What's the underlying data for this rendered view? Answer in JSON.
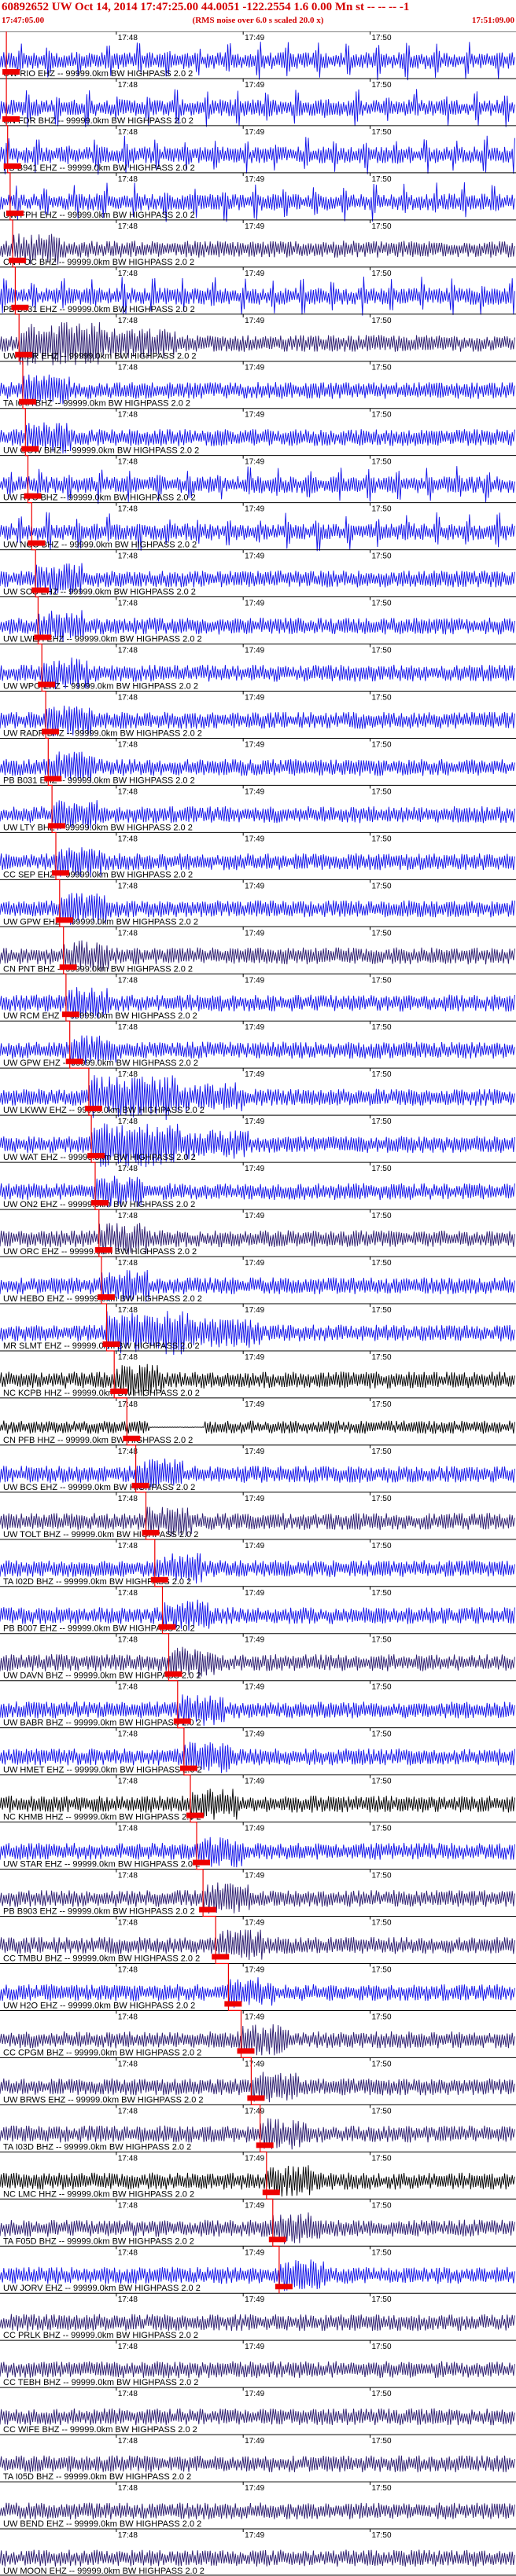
{
  "header": {
    "title": "60892652 UW Oct 14, 2014 17:47:25.00   44.0051 -122.2554  1.6 0.00 Mn st -- -- -- -1",
    "start_time": "17:47:05.00",
    "note": "(RMS noise over 6.0 s scaled 20.0 x)",
    "end_time": "17:51:09.00"
  },
  "time_axis": {
    "tick_labels": [
      "17:48",
      "17:49",
      "17:50"
    ],
    "start_minutes": 0.0,
    "end_minutes": 4.0667,
    "tick_minutes": [
      0.9167,
      1.9167,
      2.9167
    ]
  },
  "colors": {
    "trace_blue": "#1010e8",
    "trace_indigo": "#2a1a6e",
    "trace_black": "#000000",
    "pick": "#ee0000",
    "header_text": "#d40000"
  },
  "traces": [
    {
      "label": "UW RIO EHZ -- 99999.0km BW  HIGHPASS  2.0  2",
      "color": "blue",
      "style": "bursty",
      "pick_min": 0.05
    },
    {
      "label": "CN FDR BHZ -- 99999.0km BW  HIGHPASS  2.0  2",
      "color": "blue",
      "style": "bursty",
      "pick_min": 0.05
    },
    {
      "label": "PB B941 EHZ -- 99999.0km BW  HIGHPASS  2.0  2",
      "color": "blue",
      "style": "bursty",
      "pick_min": 0.06
    },
    {
      "label": "UW FPH EHZ -- 99999.0km BW  HIGHPASS  2.0  2",
      "color": "blue",
      "style": "bursty",
      "pick_min": 0.08
    },
    {
      "label": "CN POC BHZ -- 99999.0km BW  HIGHPASS  2.0  2",
      "color": "indigo",
      "style": "noise",
      "pick_min": 0.1
    },
    {
      "label": "PB B931 EHZ -- 99999.0km BW  HIGHPASS  2.0  2",
      "color": "blue",
      "style": "bursty",
      "pick_min": 0.12
    },
    {
      "label": "UW HUR EHZ -- 99999.0km BW  HIGHPASS  2.0  2",
      "color": "indigo",
      "style": "event",
      "pick_min": 0.15
    },
    {
      "label": "TA I04A BHZ -- 99999.0km BW  HIGHPASS  2.0  2",
      "color": "blue",
      "style": "noise",
      "pick_min": 0.18
    },
    {
      "label": "UW OOW BHZ -- 99999.0km BW  HIGHPASS  2.0  2",
      "color": "blue",
      "style": "noise",
      "pick_min": 0.2
    },
    {
      "label": "UW RVC BHZ -- 99999.0km BW  HIGHPASS  2.0  2",
      "color": "blue",
      "style": "bursty",
      "pick_min": 0.22
    },
    {
      "label": "UW NCO BHZ -- 99999.0km BW  HIGHPASS  2.0  2",
      "color": "blue",
      "style": "bursty",
      "pick_min": 0.25
    },
    {
      "label": "UW SOS EHZ -- 99999.0km BW  HIGHPASS  2.0  2",
      "color": "blue",
      "style": "noise",
      "pick_min": 0.28
    },
    {
      "label": "UW LWEH EHZ -- 99999.0km BW  HIGHPASS  2.0  2",
      "color": "blue",
      "style": "noise",
      "pick_min": 0.3
    },
    {
      "label": "UW WPO EHZ -- 99999.0km BW  HIGHPASS  2.0  2",
      "color": "blue",
      "style": "noise",
      "pick_min": 0.33
    },
    {
      "label": "UW RADR BHZ -- 99999.0km BW  HIGHPASS  2.0  2",
      "color": "blue",
      "style": "noise",
      "pick_min": 0.36
    },
    {
      "label": "PB B031 EHZ -- 99999.0km BW  HIGHPASS  2.0  2",
      "color": "blue",
      "style": "noise",
      "pick_min": 0.38
    },
    {
      "label": "UW LTY BHZ -- 99999.0km BW  HIGHPASS  2.0  2",
      "color": "blue",
      "style": "noise",
      "pick_min": 0.41
    },
    {
      "label": "CC SEP EHZ -- 99999.0km BW  HIGHPASS  2.0  2",
      "color": "blue",
      "style": "noise",
      "pick_min": 0.44
    },
    {
      "label": "UW GPW EHZ -- 99999.0km BW  HIGHPASS  2.0  2",
      "color": "blue",
      "style": "noise",
      "pick_min": 0.47
    },
    {
      "label": "CN PNT BHZ -- 99999.0km BW  HIGHPASS  2.0  2",
      "color": "indigo",
      "style": "noise",
      "pick_min": 0.5
    },
    {
      "label": "UW RCM EHZ -- 99999.0km BW  HIGHPASS  2.0  2",
      "color": "blue",
      "style": "noise",
      "pick_min": 0.52
    },
    {
      "label": "UW GPW EHZ -- 99999.0km BW  HIGHPASS  2.0  2",
      "color": "blue",
      "style": "noise",
      "pick_min": 0.55
    },
    {
      "label": "UW LKWW EHZ -- 99999.0km BW  HIGHPASS  2.0  2",
      "color": "blue",
      "style": "event",
      "pick_min": 0.7
    },
    {
      "label": "UW WAT EHZ -- 99999.0km BW  HIGHPASS  2.0  2",
      "color": "blue",
      "style": "event",
      "pick_min": 0.72
    },
    {
      "label": "UW ON2 EHZ -- 99999.0km BW  HIGHPASS  2.0  2",
      "color": "blue",
      "style": "noise",
      "pick_min": 0.75
    },
    {
      "label": "UW ORC EHZ -- 99999.0km BW  HIGHPASS  2.0  2",
      "color": "indigo",
      "style": "noise",
      "pick_min": 0.78
    },
    {
      "label": "UW HEBO EHZ -- 99999.0km BW  HIGHPASS  2.0  2",
      "color": "blue",
      "style": "noise",
      "pick_min": 0.8
    },
    {
      "label": "MR SLMT EHZ -- 99999.0km BW  HIGHPASS  2.0  2",
      "color": "blue",
      "style": "event",
      "pick_min": 0.84
    },
    {
      "label": "NC KCPB HHZ -- 99999.0km BW  HIGHPASS  2.0  2",
      "color": "black",
      "style": "noise",
      "pick_min": 0.9
    },
    {
      "label": "CN PFB HHZ -- 99999.0km BW  HIGHPASS  2.0  2",
      "color": "black",
      "style": "flat",
      "pick_min": 1.0
    },
    {
      "label": "UW BCS EHZ -- 99999.0km BW  HIGHPASS  2.0  2",
      "color": "blue",
      "style": "noise",
      "pick_min": 1.07
    },
    {
      "label": "UW TOLT BHZ -- 99999.0km BW  HIGHPASS  2.0  2",
      "color": "indigo",
      "style": "noise",
      "pick_min": 1.15
    },
    {
      "label": "TA I02D BHZ -- 99999.0km BW  HIGHPASS  2.0  2",
      "color": "blue",
      "style": "noise",
      "pick_min": 1.22
    },
    {
      "label": "PB B007 EHZ -- 99999.0km BW  HIGHPASS  2.0  2",
      "color": "blue",
      "style": "noise",
      "pick_min": 1.28
    },
    {
      "label": "UW DAVN BHZ -- 99999.0km BW  HIGHPASS  2.0  2",
      "color": "indigo",
      "style": "noise",
      "pick_min": 1.33
    },
    {
      "label": "UW BABR BHZ -- 99999.0km BW  HIGHPASS  2.0  2",
      "color": "blue",
      "style": "noise",
      "pick_min": 1.4
    },
    {
      "label": "UW HMET EHZ -- 99999.0km BW  HIGHPASS  2.0  2",
      "color": "blue",
      "style": "noise",
      "pick_min": 1.45
    },
    {
      "label": "NC KHMB HHZ -- 99999.0km BW  HIGHPASS  2.0  2",
      "color": "black",
      "style": "noise",
      "pick_min": 1.5
    },
    {
      "label": "UW STAR EHZ -- 99999.0km BW  HIGHPASS  2.0  2",
      "color": "blue",
      "style": "noise",
      "pick_min": 1.55
    },
    {
      "label": "PB B903 EHZ -- 99999.0km BW  HIGHPASS  2.0  2",
      "color": "indigo",
      "style": "noise",
      "pick_min": 1.6
    },
    {
      "label": "CC TMBU BHZ -- 99999.0km BW  HIGHPASS  2.0  2",
      "color": "indigo",
      "style": "noise",
      "pick_min": 1.7
    },
    {
      "label": "UW H2O EHZ -- 99999.0km BW  HIGHPASS  2.0  2",
      "color": "blue",
      "style": "noise",
      "pick_min": 1.8
    },
    {
      "label": "CC CPGM BHZ -- 99999.0km BW  HIGHPASS  2.0  2",
      "color": "indigo",
      "style": "noise",
      "pick_min": 1.9
    },
    {
      "label": "UW BRWS EHZ -- 99999.0km BW  HIGHPASS  2.0  2",
      "color": "indigo",
      "style": "noise",
      "pick_min": 1.98
    },
    {
      "label": "TA I03D BHZ -- 99999.0km BW  HIGHPASS  2.0  2",
      "color": "indigo",
      "style": "noise",
      "pick_min": 2.05
    },
    {
      "label": "NC LMC HHZ -- 99999.0km BW  HIGHPASS  2.0  2",
      "color": "black",
      "style": "noise",
      "pick_min": 2.1
    },
    {
      "label": "TA F05D BHZ -- 99999.0km BW  HIGHPASS  2.0  2",
      "color": "indigo",
      "style": "noise",
      "pick_min": 2.15
    },
    {
      "label": "UW JORV EHZ -- 99999.0km BW  HIGHPASS  2.0  2",
      "color": "blue",
      "style": "noise",
      "pick_min": 2.2
    },
    {
      "label": "CC PRLK BHZ -- 99999.0km BW  HIGHPASS  2.0  2",
      "color": "indigo",
      "style": "noise",
      "pick_min": null
    },
    {
      "label": "CC TEBH BHZ -- 99999.0km BW  HIGHPASS  2.0  2",
      "color": "indigo",
      "style": "noise",
      "pick_min": null
    },
    {
      "label": "CC WIFE BHZ -- 99999.0km BW  HIGHPASS  2.0  2",
      "color": "indigo",
      "style": "noise",
      "pick_min": null
    },
    {
      "label": "TA I05D BHZ -- 99999.0km BW  HIGHPASS  2.0  2",
      "color": "indigo",
      "style": "noise",
      "pick_min": null
    },
    {
      "label": "UW BEND EHZ -- 99999.0km BW  HIGHPASS  2.0  2",
      "color": "indigo",
      "style": "noise",
      "pick_min": null
    },
    {
      "label": "UW MOON EHZ -- 99999.0km BW  HIGHPASS  2.0  2",
      "color": "indigo",
      "style": "noise",
      "pick_min": null
    }
  ]
}
